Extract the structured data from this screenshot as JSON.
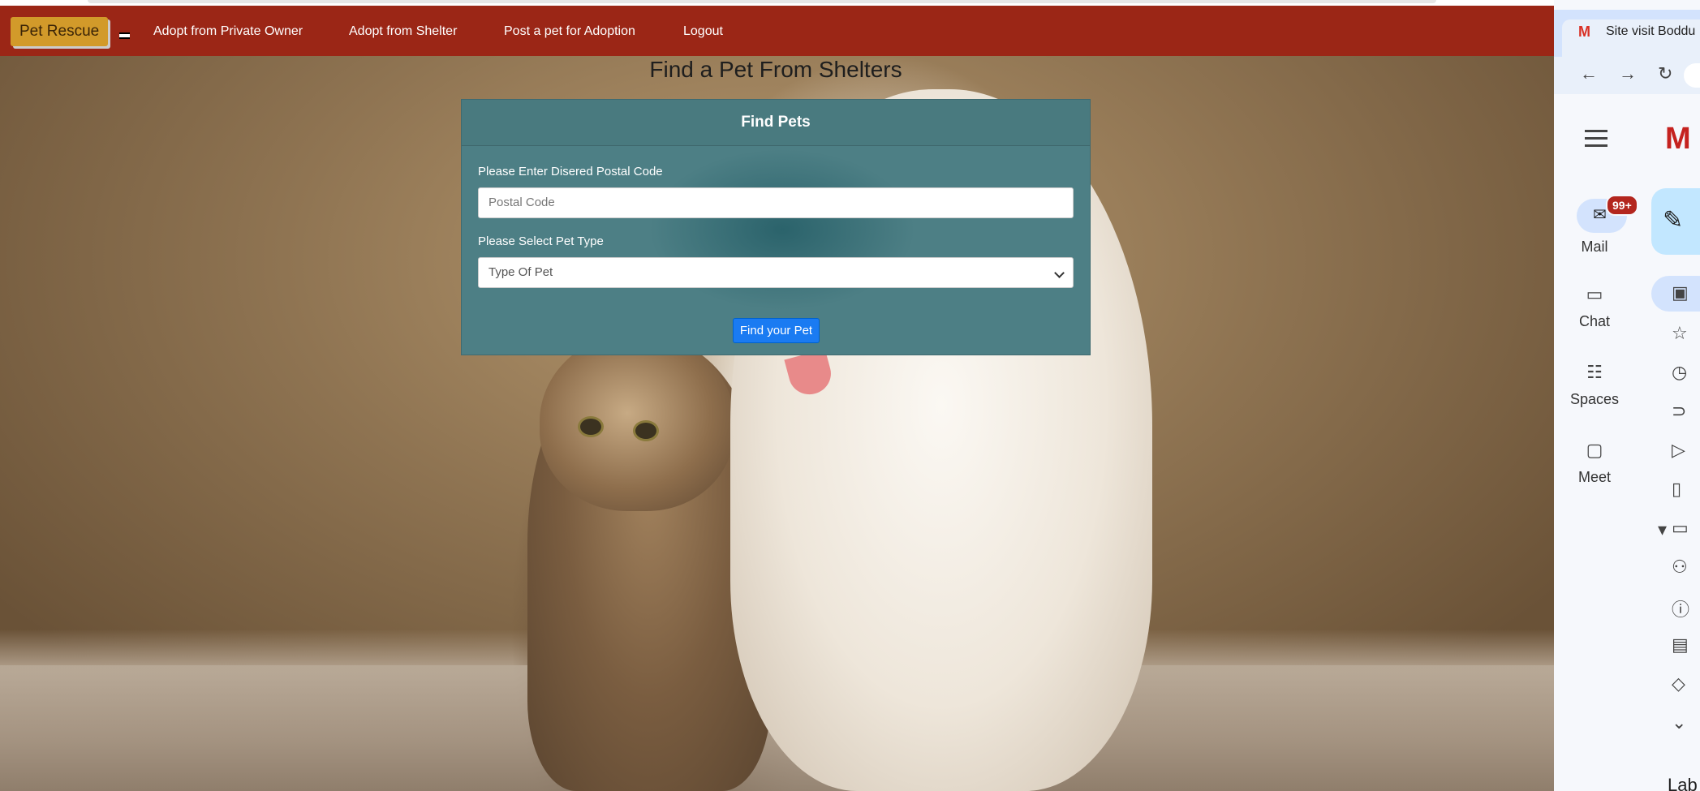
{
  "navbar": {
    "brand": "Pet Rescue",
    "links": [
      "Adopt from Private Owner",
      "Adopt from Shelter",
      "Post a pet for Adoption",
      "Logout"
    ]
  },
  "page_title": "Find a Pet From Shelters",
  "card": {
    "header": "Find Pets",
    "postal_label": "Please Enter Disered Postal Code",
    "postal_placeholder": "Postal Code",
    "pet_type_label": "Please Select Pet Type",
    "pet_type_selected": "Type Of Pet",
    "submit": "Find your Pet"
  },
  "gmail": {
    "tab_title": "Site visit Boddu",
    "rail": [
      {
        "label": "Mail",
        "icon": "mail-icon"
      },
      {
        "label": "Chat",
        "icon": "chat-icon"
      },
      {
        "label": "Spaces",
        "icon": "spaces-icon"
      },
      {
        "label": "Meet",
        "icon": "meet-icon"
      }
    ],
    "badge": "99+",
    "labels_heading": "Lab"
  },
  "colors": {
    "navbar": "#9b2616",
    "brand_bg": "#d29a2a",
    "card_bg": "#4d7f85",
    "button": "#1a7bf2"
  }
}
